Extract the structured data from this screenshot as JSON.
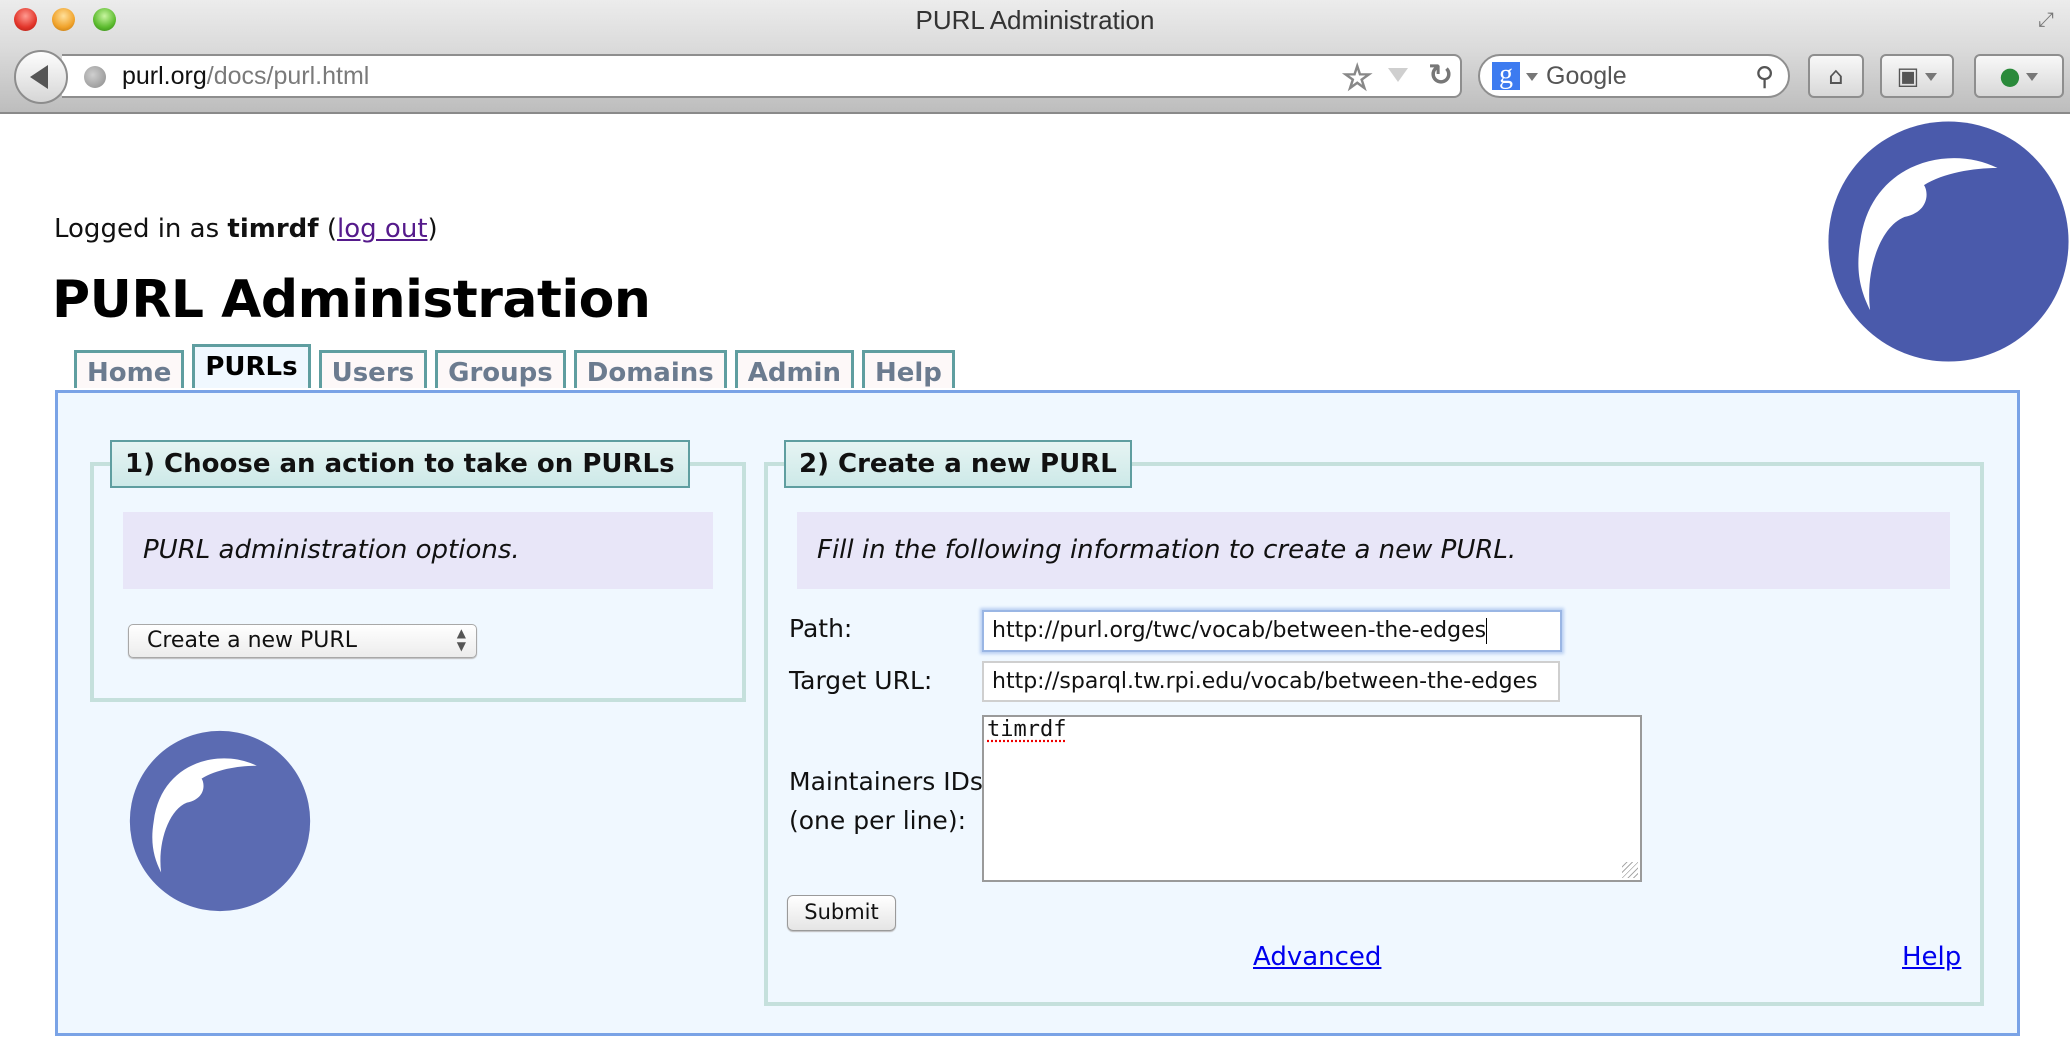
{
  "window": {
    "title": "PURL Administration"
  },
  "browser": {
    "url_host": "purl.org",
    "url_path": "/docs/purl.html",
    "search_engine_label": "Google",
    "icons": {
      "back": "back-arrow-icon",
      "site": "globe-icon",
      "bookmark": "star-icon",
      "history": "dropdown-icon",
      "reload": "reload-icon",
      "search_engine": "google-g-icon",
      "search": "magnifier-icon",
      "home": "home-icon",
      "bookmarks": "bookmarks-icon",
      "addon": "addon-pdf-icon",
      "fullscreen": "fullscreen-icon"
    }
  },
  "header": {
    "logged_in_prefix": "Logged in as ",
    "username": "timrdf",
    "logout_open": " (",
    "logout_label": "log out",
    "logout_close": ")",
    "page_title": "PURL Administration"
  },
  "tabs": [
    {
      "label": "Home",
      "active": false
    },
    {
      "label": "PURLs",
      "active": true
    },
    {
      "label": "Users",
      "active": false
    },
    {
      "label": "Groups",
      "active": false
    },
    {
      "label": "Domains",
      "active": false
    },
    {
      "label": "Admin",
      "active": false
    },
    {
      "label": "Help",
      "active": false
    }
  ],
  "action_panel": {
    "legend": "1) Choose an action to take on PURLs",
    "info": "PURL administration options.",
    "select_value": "Create a new PURL"
  },
  "create_panel": {
    "legend": "2) Create a new PURL",
    "info": "Fill in the following information to create a new PURL.",
    "path_label": "Path:",
    "path_value": "http://purl.org/twc/vocab/between-the-edges",
    "target_label": "Target URL:",
    "target_value": "http://sparql.tw.rpi.edu/vocab/between-the-edges",
    "maintainers_label_line1": "Maintainers IDs",
    "maintainers_label_line2": "(one per line):",
    "maintainers_value": "timrdf",
    "submit_label": "Submit",
    "advanced_link": "Advanced",
    "help_link": "Help"
  },
  "colors": {
    "logo_blue": "#4a5aab",
    "panel_bg": "#f0f8ff",
    "panel_border": "#7aa3e6",
    "tab_border": "#5f9ea0",
    "fieldset_border": "#c5e0dc",
    "info_bg": "#e8e6f8",
    "link": "#0000ee",
    "visited_link": "#551a8b"
  }
}
